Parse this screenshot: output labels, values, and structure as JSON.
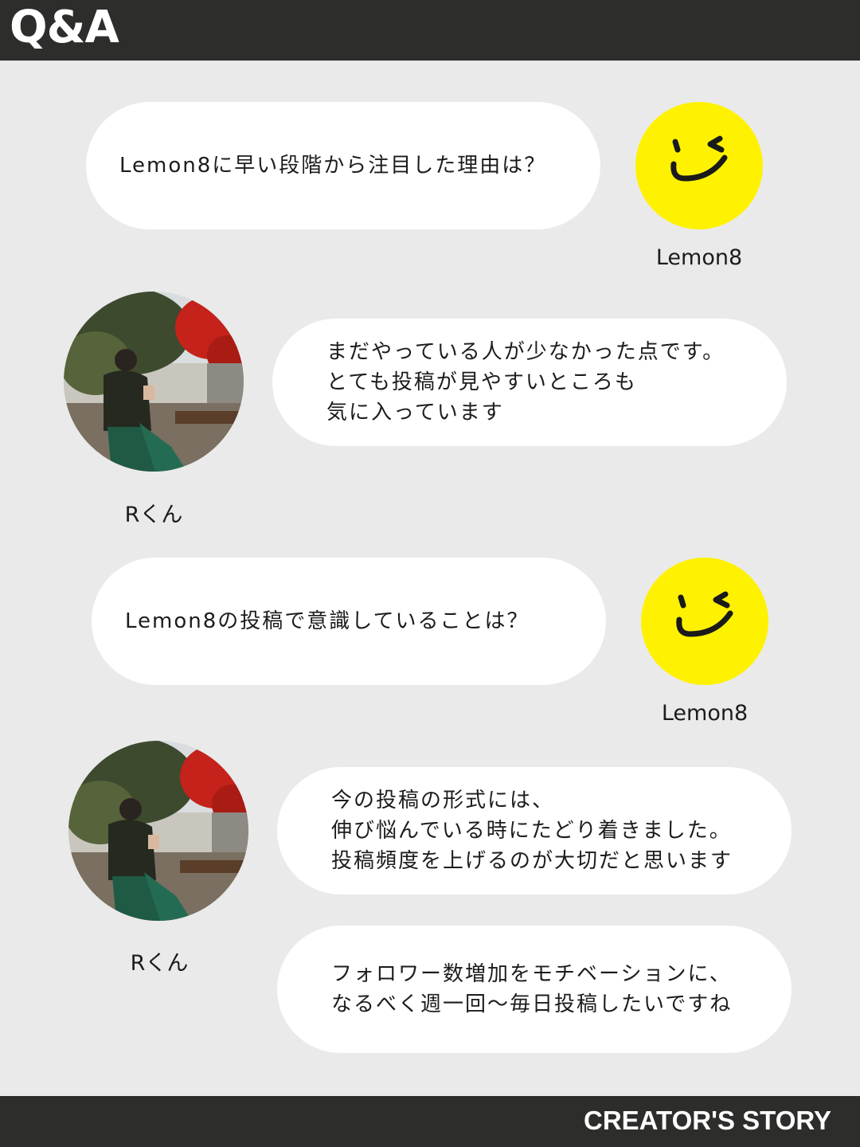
{
  "header": {
    "title": "Q&A"
  },
  "footer": {
    "label": "CREATOR'S STORY"
  },
  "colors": {
    "bar": "#2d2d2b",
    "background": "#eaeaea",
    "lemon_yellow": "#fff200",
    "bubble": "#ffffff"
  },
  "qa": [
    {
      "role": "question",
      "name": "Lemon8",
      "avatar_icon": "lemon8-smile-logo-icon",
      "lines": [
        "Lemon8に早い段階から注目した理由は？"
      ]
    },
    {
      "role": "answer",
      "name": "Rくん",
      "avatar_icon": "profile-photo",
      "lines": [
        "まだやっている人が少なかった点です。",
        "とても投稿が見やすいところも",
        "気に入っています"
      ]
    },
    {
      "role": "question",
      "name": "Lemon8",
      "avatar_icon": "lemon8-smile-logo-icon",
      "lines": [
        "Lemon8の投稿で意識していることは？"
      ]
    },
    {
      "role": "answer",
      "name": "Rくん",
      "avatar_icon": "profile-photo",
      "lines": [
        "今の投稿の形式には、",
        "伸び悩んでいる時にたどり着きました。",
        "投稿頻度を上げるのが大切だと思います"
      ]
    },
    {
      "role": "answer",
      "name": "Rくん",
      "avatar_icon": "profile-photo",
      "lines": [
        "フォロワー数増加をモチベーションに、",
        "なるべく週一回〜毎日投稿したいですね"
      ]
    }
  ]
}
